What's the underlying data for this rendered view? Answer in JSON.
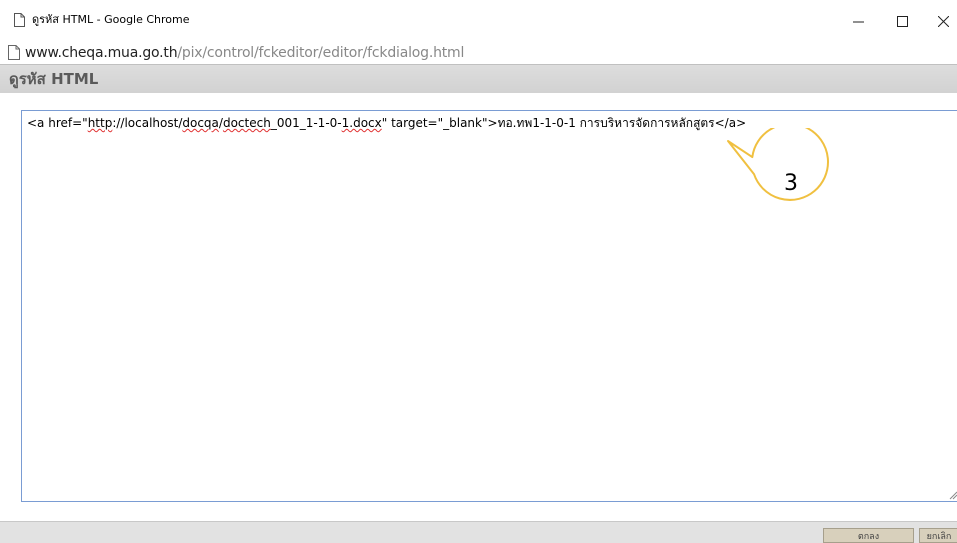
{
  "window": {
    "title": "ดูรหัส HTML - Google Chrome",
    "controls": {
      "minimize": "–",
      "maximize": "☐",
      "close": "✕"
    }
  },
  "address_bar": {
    "host": "www.cheqa.mua.go.th",
    "path": "/pix/control/fckeditor/editor/fckdialog.html"
  },
  "dialog": {
    "title": "ดูรหัส HTML",
    "source_code": {
      "p1": "<a href=\"",
      "p2": "http",
      "p3": "://localhost/",
      "p4": "docqa",
      "p5": "/",
      "p6": "doctech",
      "p7": "_001_1-1-0-",
      "p8": "1.docx",
      "p9": "\" target=\"_blank\">ทอ.ทพ1-1-0-1 การบริหารจัดการหลักสูตร</a>"
    },
    "callout_number": "3",
    "buttons": {
      "ok": "ตกลง",
      "cancel": "ยกเลิก"
    }
  },
  "icons": [
    "page-icon",
    "minimize-icon",
    "maximize-icon",
    "close-icon",
    "resize-grip-icon"
  ],
  "colors": {
    "header_bg": "#d8d8d8",
    "textarea_border": "#7a9cd3",
    "callout_stroke": "#f0c040",
    "button_bg": "#d8d0bc"
  }
}
